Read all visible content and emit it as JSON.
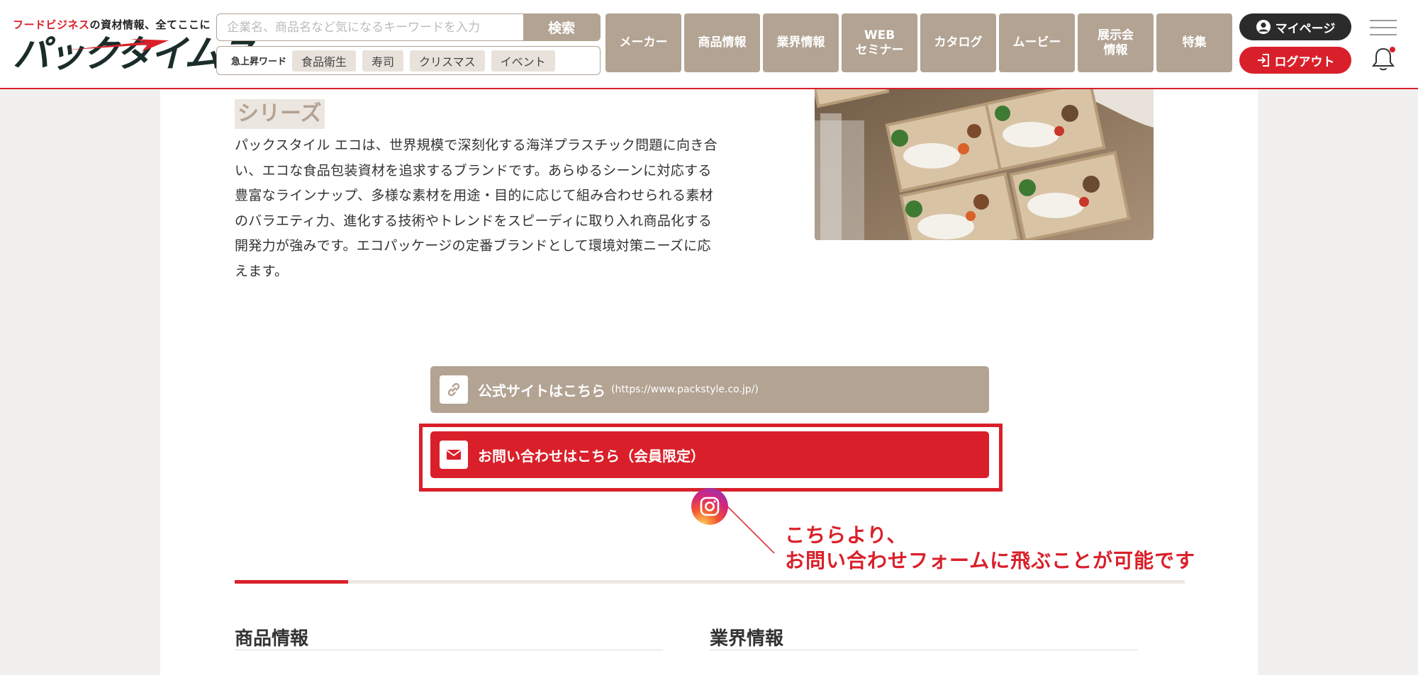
{
  "header": {
    "logo": {
      "tagline_accent": "フードビジネス",
      "tagline_rest": "の資材情報、全てここに",
      "wordmark": "パックタイムス"
    },
    "search": {
      "placeholder": "企業名、商品名など気になるキーワードを入力",
      "value": "",
      "button_label": "検索"
    },
    "trending": {
      "label": "急上昇ワード",
      "tags": [
        "食品衛生",
        "寿司",
        "クリスマス",
        "イベント"
      ]
    },
    "nav": [
      "メーカー",
      "商品情報",
      "業界情報",
      "WEB\nセミナー",
      "カタログ",
      "ムービー",
      "展示会\n情報",
      "特集"
    ],
    "mypage_label": "マイページ",
    "logout_label": "ログアウト"
  },
  "main": {
    "section_heading": "シリーズ",
    "intro_lines": [
      "パックスタイル エコは、世界規模で深刻化する海洋プラスチック問題に向き合",
      "い、エコな食品包装資材を追求するブランドです。あらゆるシーンに対応する",
      "豊富なラインナップ、多様な素材を用途・目的に応じて組み合わせられる素材",
      "のバラエティ力、進化する技術やトレンドをスピーディに取り入れ商品化する",
      "開発力が強みです。エコパッケージの定番ブランドとして環境対策ニーズに応",
      "えます。"
    ],
    "official_site": {
      "label": "公式サイトはこちら",
      "url": "(https://www.packstyle.co.jp/)"
    },
    "contact": {
      "label": "お問い合わせはこちら（会員限定）"
    },
    "callout_lines": [
      "こちらより、",
      "お問い合わせフォームに飛ぶことが可能です"
    ],
    "footer": {
      "left_heading": "商品情報",
      "right_heading": "業界情報"
    }
  },
  "colors": {
    "accent_red": "#d9202a",
    "taupe": "#b3a393",
    "page_bg": "#f2f0ee",
    "dark": "#2b2b2b"
  },
  "icons": {
    "search": "none",
    "mypage": "user-circle-icon",
    "logout": "logout-icon",
    "menu": "hamburger-menu-icon",
    "notifications": "bell-icon",
    "official_site": "link-icon",
    "contact": "envelope-icon",
    "social": "instagram-icon"
  }
}
